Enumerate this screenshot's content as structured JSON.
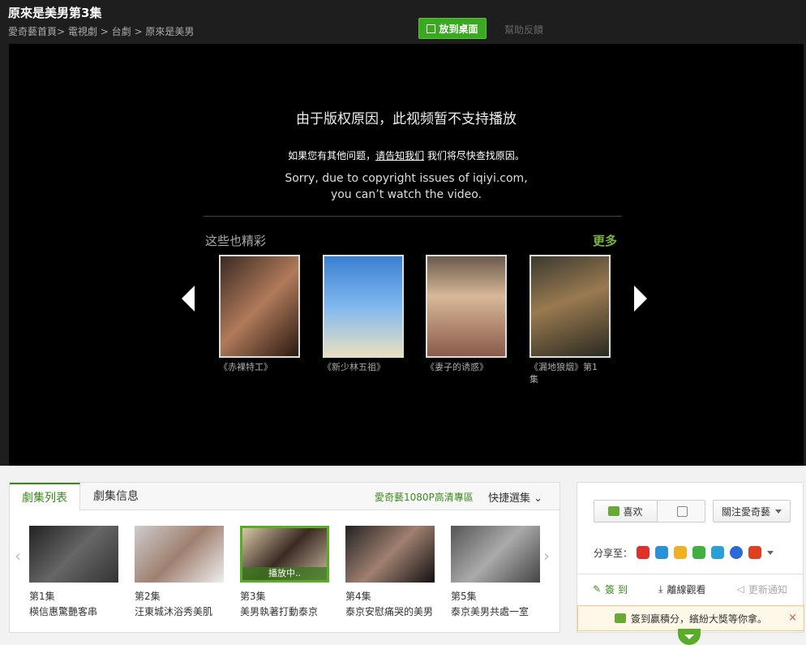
{
  "header": {
    "title": "原來是美男第3集",
    "breadcrumb": [
      "愛奇藝首頁>",
      "電視劇",
      ">",
      "台劇",
      ">",
      "原來是美男"
    ],
    "desktop_button": "放到桌面",
    "help_link": "幫助反饋"
  },
  "player": {
    "message_cn": "由于版权原因，此视频暂不支持播放",
    "message_contact_prefix": "如果您有其他问题，",
    "message_contact_link": "请告知我们",
    "message_contact_suffix": " 我们将尽快查找原因。",
    "message_en_line1": "Sorry, due to copyright issues of iqiyi.com,",
    "message_en_line2": "you can’t watch the video.",
    "recommend_title": "这些也精彩",
    "recommend_more": "更多",
    "recommendations": [
      {
        "caption": "《赤裸特工》"
      },
      {
        "caption": "《新少林五祖》"
      },
      {
        "caption": "《妻子的诱惑》"
      },
      {
        "caption": "《漏地狼烟》第1集"
      }
    ]
  },
  "episodes_panel": {
    "tab_list": "劇集列表",
    "tab_info": "劇集信息",
    "hd_link": "愛奇藝1080P高清專區",
    "quick_select": "快捷選集",
    "playing_label": "播放中..",
    "episodes": [
      {
        "num": "第1集",
        "name": "楧信惠驚艷客串"
      },
      {
        "num": "第2集",
        "name": "汪東城沐浴秀美肌"
      },
      {
        "num": "第3集",
        "name": "美男執著打動泰京"
      },
      {
        "num": "第4集",
        "name": "泰京安慰痛哭的美男"
      },
      {
        "num": "第5集",
        "name": "泰京美男共處一室"
      }
    ]
  },
  "side_panel": {
    "like_label": "喜欢",
    "follow_label": "關注愛奇藝",
    "share_label": "分享至：",
    "sign_in": "簽 到",
    "offline": "離線觀看",
    "update_notice": "更新通知",
    "notice_text": "簽到赢積分，繽紛大獎等你拿。"
  },
  "colors": {
    "accent_green": "#3aa820",
    "player_bg": "#000000"
  }
}
